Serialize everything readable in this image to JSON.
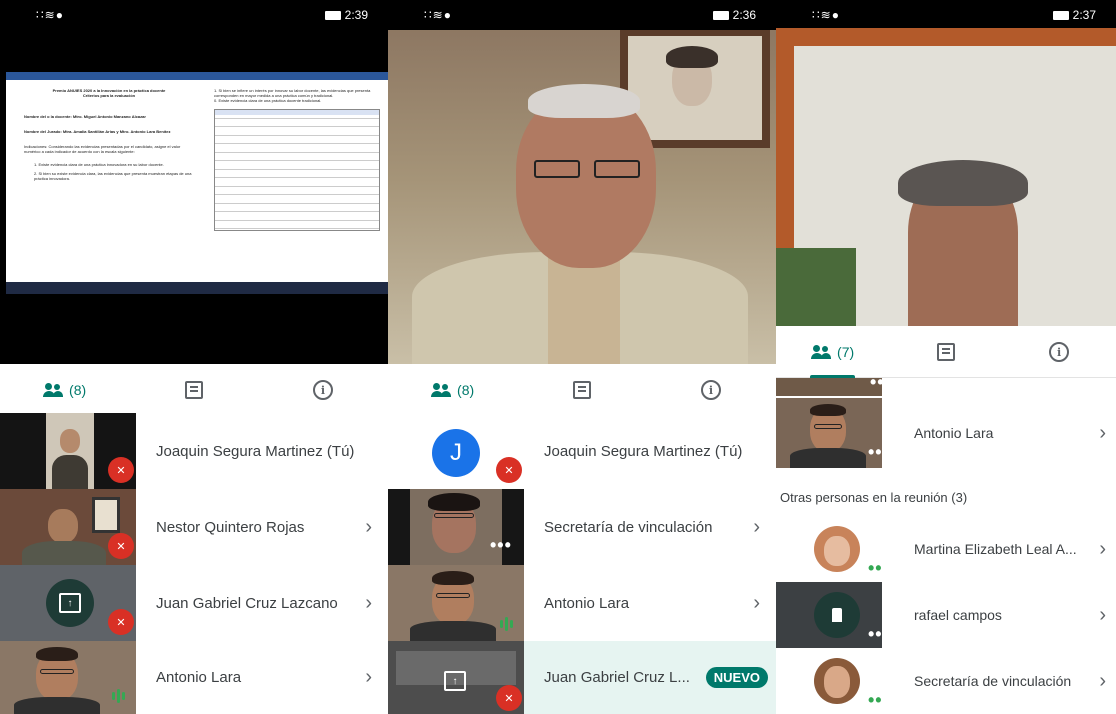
{
  "panel1": {
    "status": {
      "signal": "∷≋●",
      "time": "2:39"
    },
    "doc": {
      "title": "Premio ANUIES 2020 a la Innovación en la práctica docente",
      "subtitle": "Criterios para la evaluación",
      "docente": "Nombre del o la docente: Mtro. Miguel Antonio Manzano Alcazar",
      "jurado": "Nombre del Jurado: Mtra. Amalia Santillán Arias y Mtro. Antonio Lara Benítez",
      "indicaciones": "Indicaciones: Considerando las evidencias presentadas por el candidato, asigne el valor numérico a cada indicador de acuerdo con la escala siguiente:",
      "item1": "1. Existe evidencia clara de una práctica innovadora en su labor docente.",
      "item2": "2. Si bien su existe evidencia clara, las evidencias que presenta muestran etapas de una práctica innovadora.",
      "right1": "1. Si bien se infiere un interés por innovar su labor docente, las evidencias que presenta corresponden en mayor medida a una práctica común y tradicional.",
      "right2": "0. Existe evidencia clara de una práctica docente tradicional."
    },
    "tabs": {
      "people_count": "(8)"
    },
    "participants": [
      {
        "name": "Joaquin Segura Martinez (Tú)",
        "muted": true
      },
      {
        "name": "Nestor Quintero Rojas",
        "muted": true
      },
      {
        "name": "Juan Gabriel Cruz Lazcano",
        "muted": true
      },
      {
        "name": "Antonio Lara",
        "muted": false
      }
    ]
  },
  "panel2": {
    "status": {
      "signal": "∷≋●",
      "time": "2:36"
    },
    "tabs": {
      "people_count": "(8)"
    },
    "avatar_letter": "J",
    "participants": [
      {
        "name": "Joaquin Segura Martinez (Tú)"
      },
      {
        "name": "Secretaría de vinculación"
      },
      {
        "name": "Antonio Lara"
      },
      {
        "name": "Juan Gabriel Cruz L...",
        "badge": "NUEVO"
      }
    ]
  },
  "panel3": {
    "status": {
      "signal": "∷≋●",
      "time": "2:37"
    },
    "tabs": {
      "people_count": "(7)"
    },
    "top_participant": "Antonio Lara",
    "section_header": "Otras personas en la reunión (3)",
    "others": [
      {
        "name": "Martina Elizabeth Leal A..."
      },
      {
        "name": "rafael campos"
      },
      {
        "name": "Secretaría de vinculación"
      }
    ]
  },
  "icons": {
    "chevron": "›",
    "mic_off": "✕",
    "dots": "•••",
    "present": "↑"
  },
  "colors": {
    "accent": "#00796b",
    "muted": "#d93025",
    "speaking": "#34a853"
  }
}
